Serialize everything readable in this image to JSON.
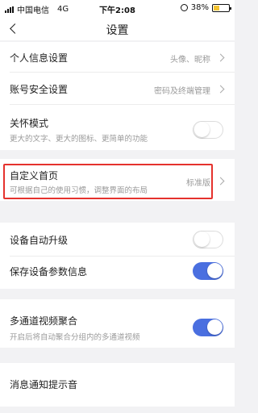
{
  "status_bar": {
    "carrier": "中国电信",
    "network": "4G",
    "time": "下午2:08",
    "battery_percent": "38%",
    "battery_level": 0.38,
    "battery_color": "#f2c230"
  },
  "nav": {
    "title": "设置",
    "back_icon": "chevron-left-icon"
  },
  "settings": {
    "personal_info": {
      "label": "个人信息设置",
      "value": "头像、昵称"
    },
    "account_security": {
      "label": "账号安全设置",
      "value": "密码及终端管理"
    },
    "care_mode": {
      "label": "关怀模式",
      "sub": "更大的文字、更大的图标、更简单的功能",
      "enabled": false
    },
    "custom_home": {
      "label": "自定义首页",
      "sub": "可根据自己的使用习惯，调整界面的布局",
      "value": "标准版"
    },
    "auto_upgrade": {
      "label": "设备自动升级",
      "enabled": false
    },
    "save_params": {
      "label": "保存设备参数信息",
      "enabled": true
    },
    "multi_channel": {
      "label": "多通道视频聚合",
      "sub": "开启后将自动聚合分组内的多通道视频",
      "enabled": true
    },
    "notification_sound": {
      "label": "消息通知提示音"
    }
  },
  "colors": {
    "accent": "#4a6fe0",
    "highlight_border": "#e5322d",
    "background": "#f2f2f4"
  }
}
